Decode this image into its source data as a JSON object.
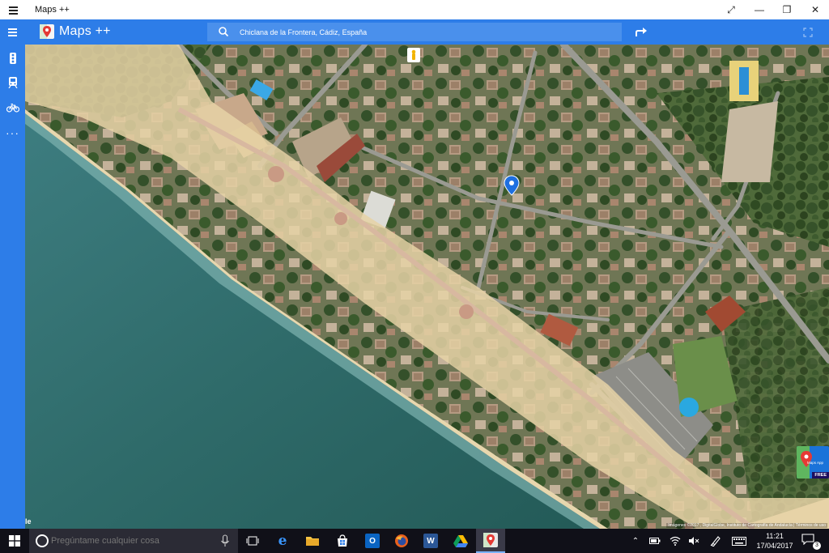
{
  "window": {
    "title": "Maps ++",
    "controls": [
      "maximize-icon",
      "minimize-icon",
      "restore-icon",
      "close-icon"
    ]
  },
  "header": {
    "brand": "Maps ++",
    "search": {
      "value": "Chiclana de la Frontera, Cádiz, España"
    },
    "icons": [
      "menu-icon",
      "search-icon",
      "route-arrow-icon",
      "fullscreen-icon"
    ]
  },
  "rail": {
    "items": [
      "traffic-light-icon",
      "train-icon",
      "bicycle-icon",
      "more-icon"
    ]
  },
  "map": {
    "corner_label": "le",
    "attribution": "Imágenes ©2017 , DigitalGlobe, Instituto de Cartografía de Andalucía | Términos de uso",
    "promo": {
      "title": "Maps App",
      "badge": "FREE"
    }
  },
  "taskbar": {
    "search_placeholder": "Pregúntame cualquier cosa",
    "apps": [
      "task-view-icon",
      "edge-icon",
      "file-explorer-icon",
      "store-icon",
      "outlook-icon",
      "firefox-icon",
      "word-icon",
      "google-drive-icon",
      "maps-plus-icon"
    ],
    "tray": [
      "chevron-up-icon",
      "battery-icon",
      "wifi-icon",
      "volume-muted-icon",
      "pen-icon",
      "keyboard-icon"
    ],
    "time": "11:21",
    "date": "17/04/2017",
    "notifications": "3"
  },
  "colors": {
    "accent": "#2d7de8",
    "sea": "#2f6b6a",
    "sand": "#e6d2a6",
    "taskbar": "#101018"
  }
}
